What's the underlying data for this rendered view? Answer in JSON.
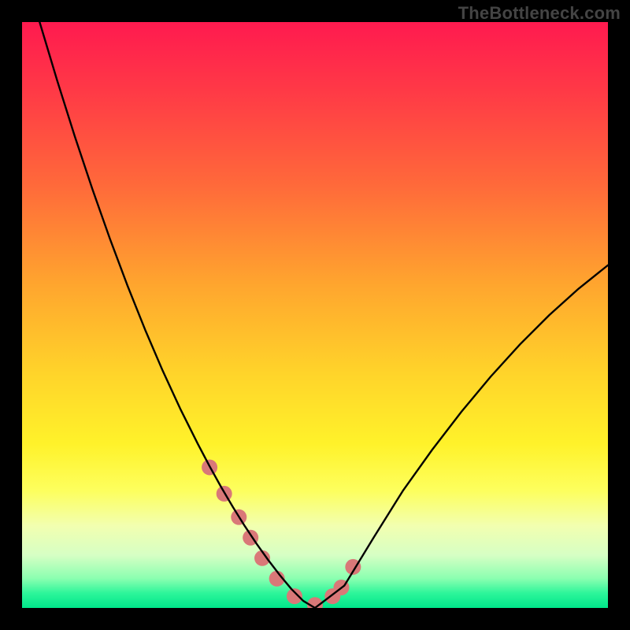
{
  "watermark": "TheBottleneck.com",
  "chart_data": {
    "type": "line",
    "title": "",
    "xlabel": "",
    "ylabel": "",
    "xlim": [
      0,
      100
    ],
    "ylim": [
      0,
      100
    ],
    "x": [
      3,
      6,
      9,
      12,
      15,
      18,
      21,
      24,
      27,
      30,
      32,
      34,
      36,
      38,
      40,
      42,
      44,
      46,
      48,
      50,
      55,
      60,
      65,
      70,
      75,
      80,
      85,
      90,
      95,
      100
    ],
    "values": [
      100,
      90,
      80.5,
      71.5,
      63,
      55,
      47.5,
      40.5,
      34,
      28,
      24.2,
      20.6,
      17.2,
      14,
      11,
      8.2,
      5.6,
      3.2,
      1.2,
      0,
      3.8,
      12,
      20,
      27,
      33.5,
      39.5,
      45,
      50,
      54.5,
      58.5
    ],
    "overlay_points": {
      "x": [
        32,
        34.5,
        37,
        39,
        41,
        43.5,
        46.5,
        50,
        53,
        54.5,
        56.5
      ],
      "y": [
        24,
        19.5,
        15.5,
        12,
        8.5,
        5,
        2,
        0.5,
        2,
        3.5,
        7
      ]
    },
    "gradient_stops": [
      {
        "offset": 0.0,
        "color": "#ff1a4f"
      },
      {
        "offset": 0.12,
        "color": "#ff3a46"
      },
      {
        "offset": 0.28,
        "color": "#ff6a3a"
      },
      {
        "offset": 0.45,
        "color": "#ffa62e"
      },
      {
        "offset": 0.6,
        "color": "#ffd42a"
      },
      {
        "offset": 0.72,
        "color": "#fff22a"
      },
      {
        "offset": 0.8,
        "color": "#fdff5e"
      },
      {
        "offset": 0.86,
        "color": "#f2ffb0"
      },
      {
        "offset": 0.91,
        "color": "#d6ffc4"
      },
      {
        "offset": 0.95,
        "color": "#8affb0"
      },
      {
        "offset": 0.975,
        "color": "#2cf59a"
      },
      {
        "offset": 1.0,
        "color": "#00e68a"
      }
    ],
    "marker_color": "#d97878",
    "marker_radius": 10,
    "curve_stroke": "#000000",
    "curve_width": 2.4
  }
}
